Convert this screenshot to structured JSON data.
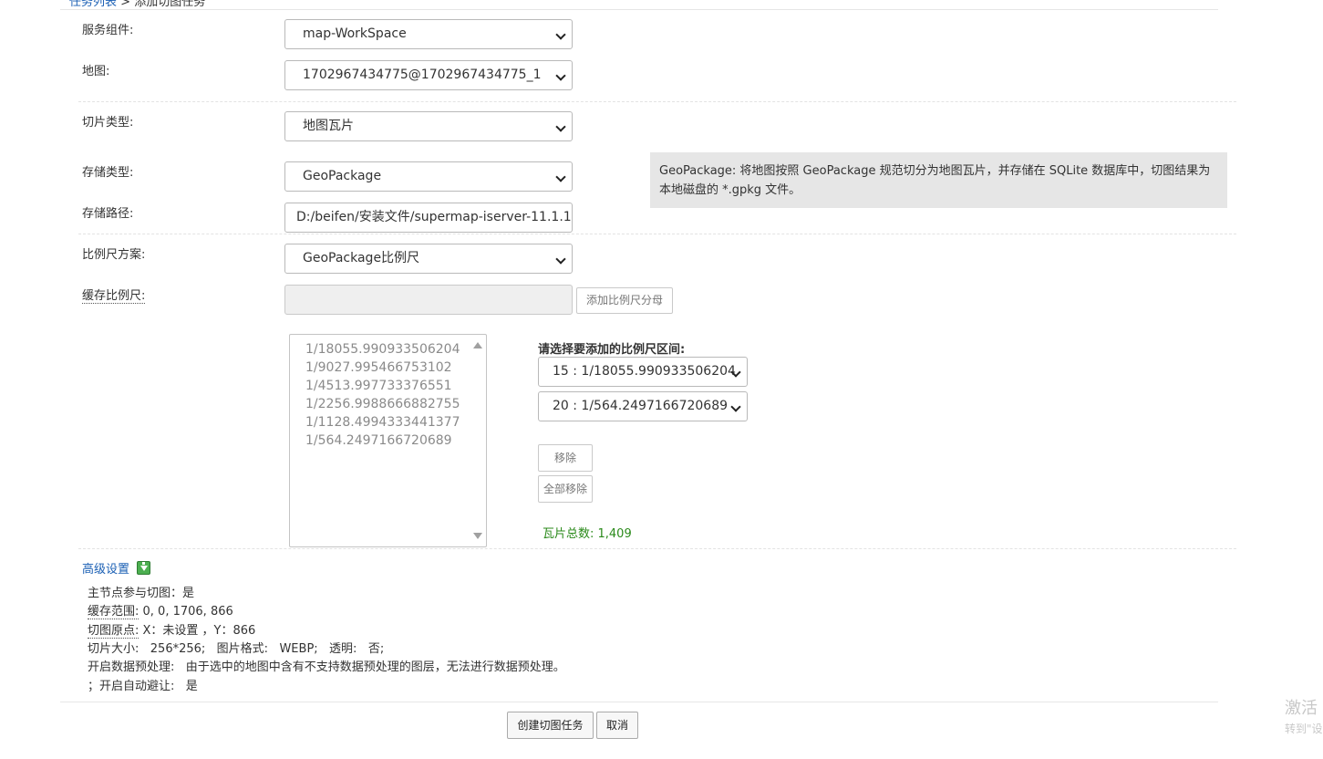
{
  "breadcrumb": {
    "link": "任务列表",
    "sep": " > ",
    "current": "添加切图任务"
  },
  "form": {
    "service_component": {
      "label": "服务组件:",
      "value": "map-WorkSpace"
    },
    "map": {
      "label": "地图:",
      "value": "1702967434775@1702967434775_1"
    },
    "tile_type": {
      "label": "切片类型:",
      "value": "地图瓦片"
    },
    "storage_type": {
      "label": "存储类型:",
      "value": "GeoPackage"
    },
    "storage_path": {
      "label": "存储路径:",
      "value": "D:/beifen/安装文件/supermap-iserver-11.1.1"
    },
    "scale_scheme": {
      "label": "比例尺方案:",
      "value": "GeoPackage比例尺"
    },
    "cache_scale": {
      "label": "缓存比例尺:",
      "value": "",
      "add_button": "添加比例尺分母"
    }
  },
  "storage_info": "GeoPackage: 将地图按照 GeoPackage 规范切分为地图瓦片，并存储在 SQLite 数据库中，切图结果为本地磁盘的 *.gpkg 文件。",
  "scale_list": [
    "1/18055.990933506204",
    "1/9027.995466753102",
    "1/4513.997733376551",
    "1/2256.9988666882755",
    "1/1128.4994333441377",
    "1/564.2497166720689"
  ],
  "range": {
    "title": "请选择要添加的比例尺区间:",
    "from": "15 : 1/18055.990933506204",
    "to": "20 : 1/564.2497166720689",
    "remove_button": "移除",
    "remove_all_button": "全部移除"
  },
  "tile_total": "瓦片总数: 1,409",
  "advanced": {
    "title": "高级设置",
    "master_node": "主节点参与切图：是",
    "cache_bounds_label": "缓存范围:",
    "cache_bounds_value": " 0, 0, 1706, 866",
    "origin_label": "切图原点:",
    "origin_value": " X：未设置 ，Y：866",
    "tile_size": "切片大小:   256*256;   图片格式:   WEBP;   透明:   否;",
    "preprocess": "开启数据预处理:   由于选中的地图中含有不支持数据预处理的图层，无法进行数据预处理。",
    "avoidance": "；开启自动避让:   是"
  },
  "actions": {
    "create": "创建切图任务",
    "cancel": "取消"
  },
  "watermark": {
    "line1": "激活",
    "line2": "转到\"设"
  }
}
